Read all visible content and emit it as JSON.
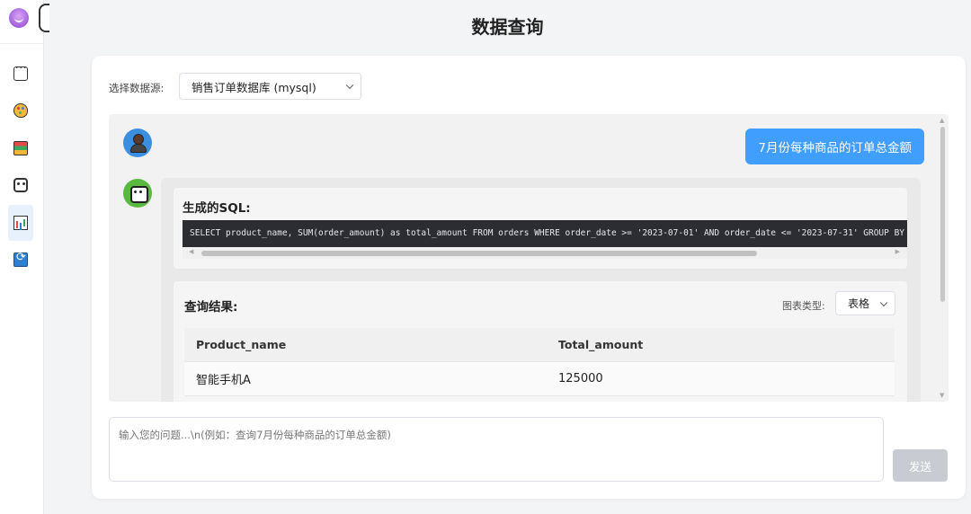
{
  "app": {
    "page_title": "数据查询"
  },
  "sidebar": {
    "items": [
      {
        "icon": "chat-icon",
        "active": false
      },
      {
        "icon": "palette-icon",
        "active": false
      },
      {
        "icon": "books-icon",
        "active": false
      },
      {
        "icon": "robot-icon",
        "active": false
      },
      {
        "icon": "bar-chart-icon",
        "active": true
      },
      {
        "icon": "sync-icon",
        "active": false
      }
    ]
  },
  "datasource": {
    "label": "选择数据源:",
    "selected": "销售订单数据库 (mysql)"
  },
  "conversation": {
    "user_message": "7月份每种商品的订单总金额",
    "sql_title": "生成的SQL:",
    "sql_code": "SELECT product_name, SUM(order_amount) as total_amount FROM orders WHERE order_date >= '2023-07-01' AND order_date <= '2023-07-31' GROUP BY product_name",
    "result_title": "查询结果:",
    "chart_type_label": "图表类型:",
    "chart_type_selected": "表格",
    "table": {
      "columns": [
        "Product_name",
        "Total_amount"
      ],
      "rows": [
        [
          "智能手机A",
          "125000"
        ]
      ]
    }
  },
  "input": {
    "placeholder": "输入您的问题...\\n(例如：查询7月份每种商品的订单总金额)",
    "value": "",
    "send_label": "发送"
  },
  "colors": {
    "accent": "#409eff",
    "send_disabled": "#c8cbd1",
    "code_bg": "#2b2d33",
    "active_nav_bg": "#e6f1fc"
  }
}
